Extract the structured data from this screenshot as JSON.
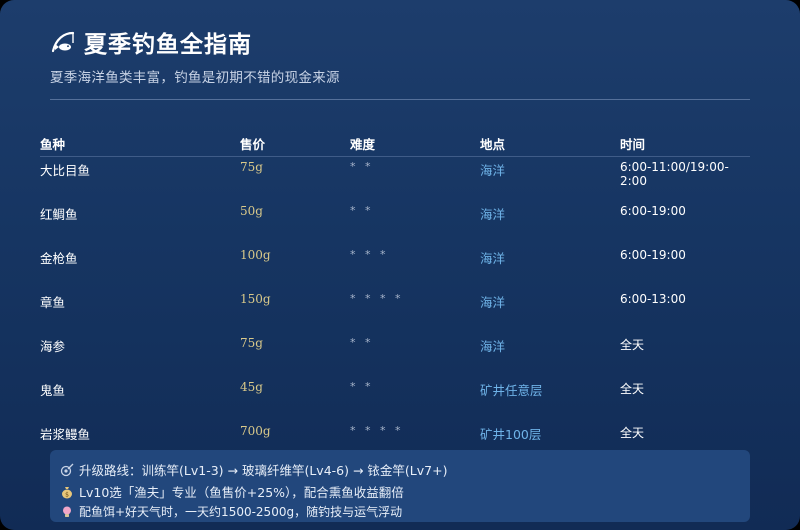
{
  "header": {
    "icon": "fishing-icon",
    "title": "夏季钓鱼全指南",
    "subtitle": "夏季海洋鱼类丰富，钓鱼是初期不错的现金来源"
  },
  "table": {
    "columns": [
      "鱼种",
      "售价",
      "难度",
      "地点",
      "时间"
    ],
    "rows": [
      {
        "name": "大比目鱼",
        "price": "75g",
        "difficulty": "* *",
        "location": "海洋",
        "time": "6:00-11:00/19:00-2:00"
      },
      {
        "name": "红鲷鱼",
        "price": "50g",
        "difficulty": "* *",
        "location": "海洋",
        "time": "6:00-19:00"
      },
      {
        "name": "金枪鱼",
        "price": "100g",
        "difficulty": "* * *",
        "location": "海洋",
        "time": "6:00-19:00"
      },
      {
        "name": "章鱼",
        "price": "150g",
        "difficulty": "* * * *",
        "location": "海洋",
        "time": "6:00-13:00"
      },
      {
        "name": "海参",
        "price": "75g",
        "difficulty": "* *",
        "location": "海洋",
        "time": "全天"
      },
      {
        "name": "鬼鱼",
        "price": "45g",
        "difficulty": "* *",
        "location": "矿井任意层",
        "time": "全天"
      },
      {
        "name": "岩浆鳗鱼",
        "price": "700g",
        "difficulty": "* * * *",
        "location": "矿井100层",
        "time": "全天"
      }
    ]
  },
  "footer": {
    "lines": [
      {
        "icon": "rod-icon",
        "text": "升级路线：训练竿(Lv1-3) → 玻璃纤维竿(Lv4-6) → 铱金竿(Lv7+)"
      },
      {
        "icon": "money-bag-icon",
        "text": "Lv10选「渔夫」专业（鱼售价+25%），配合熏鱼收益翻倍"
      },
      {
        "icon": "lightbulb-icon",
        "text": "配鱼饵+好天气时，一天约1500-2500g，随钓技与运气浮动"
      }
    ]
  },
  "colors": {
    "background_top": "#1d3d6c",
    "background_bottom": "#112b55",
    "price": "#d9c98a",
    "location": "#6fb3e8",
    "footer_bg": "#22477c"
  }
}
